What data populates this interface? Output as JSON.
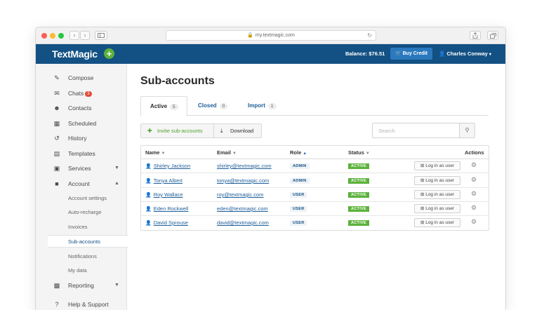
{
  "browser": {
    "url": "my.textmagic.com",
    "back_icon": "‹",
    "forward_icon": "›"
  },
  "header": {
    "logo": "TextMagic",
    "logo_plus": "+",
    "balance": "Balance: $76.51",
    "buy_credit": "Buy Credit",
    "user_name": "Charles Conway"
  },
  "sidebar": {
    "items": [
      {
        "label": "Compose",
        "icon": "compose-icon"
      },
      {
        "label": "Chats",
        "icon": "chats-icon",
        "badge": "3"
      },
      {
        "label": "Contacts",
        "icon": "contacts-icon"
      },
      {
        "label": "Scheduled",
        "icon": "calendar-icon"
      },
      {
        "label": "History",
        "icon": "history-icon"
      },
      {
        "label": "Templates",
        "icon": "templates-icon"
      },
      {
        "label": "Services",
        "icon": "services-icon"
      },
      {
        "label": "Account",
        "icon": "account-icon"
      }
    ],
    "account_sub": [
      "Account settings",
      "Auto-recharge",
      "Invoices",
      "Sub-accounts",
      "Notifications",
      "My data"
    ],
    "bottom_items": [
      {
        "label": "Reporting",
        "icon": "reporting-icon"
      },
      {
        "label": "Help & Support",
        "icon": "help-icon"
      }
    ]
  },
  "main": {
    "title": "Sub-accounts",
    "tabs": [
      {
        "label": "Active",
        "count": "5"
      },
      {
        "label": "Closed",
        "count": "0"
      },
      {
        "label": "Import",
        "count": "1"
      }
    ],
    "toolbar": {
      "invite_label": "Invite sub-accounts",
      "download_label": "Download",
      "search_placeholder": "Search"
    },
    "table": {
      "columns": [
        "Name",
        "Email",
        "Role",
        "Status",
        "Actions"
      ],
      "rows": [
        {
          "name": "Shirley Jackson",
          "email": "shirley@textmagic.com",
          "role": "ADMIN",
          "status": "ACTIVE",
          "action": "Log in as user"
        },
        {
          "name": "Tonya Albert",
          "email": "tonya@textmagic.com",
          "role": "ADMIN",
          "status": "ACTIVE",
          "action": "Log in as user"
        },
        {
          "name": "Roy Wallace",
          "email": "roy@textmagic.com",
          "role": "USER",
          "status": "ACTIVE",
          "action": "Log in as user"
        },
        {
          "name": "Eden Rockwell",
          "email": "eden@textmagic.com",
          "role": "USER",
          "status": "ACTIVE",
          "action": "Log in as user"
        },
        {
          "name": "David Sprouse",
          "email": "david@textmagic.com",
          "role": "USER",
          "status": "ACTIVE",
          "action": "Log in as user"
        }
      ]
    }
  },
  "colors": {
    "brand": "#135184",
    "accent_green": "#5cb23c",
    "badge_red": "#e24b3a"
  }
}
